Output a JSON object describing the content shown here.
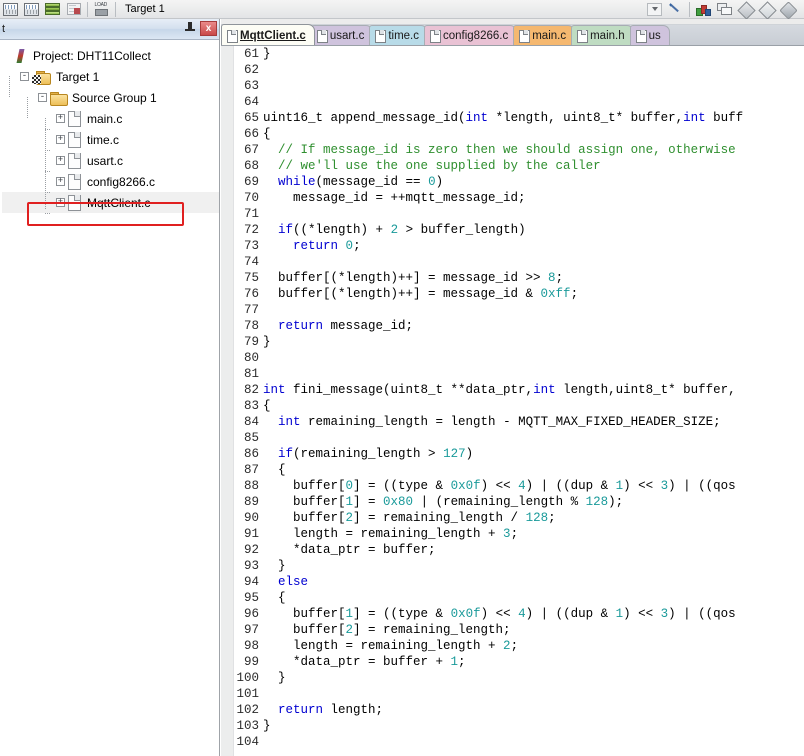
{
  "toolbar": {
    "target_label": "Target 1",
    "icons_left": [
      {
        "name": "build-icon",
        "title": "Build"
      },
      {
        "name": "rebuild-icon",
        "title": "Rebuild"
      },
      {
        "name": "batch-build-icon",
        "title": "Batch Build"
      },
      {
        "name": "stop-build-icon",
        "title": "Stop Build"
      },
      {
        "name": "download-load-icon",
        "title": "LOAD"
      }
    ],
    "icons_right": [
      {
        "name": "target-dropdown-icon",
        "title": "Select Target"
      },
      {
        "name": "options-for-target-wand-icon",
        "title": "Options for Target"
      },
      {
        "name": "manage-components-icon",
        "title": "Manage Components"
      },
      {
        "name": "manage-windows-icon",
        "title": "Manage Windows"
      },
      {
        "name": "insert-element-icon",
        "title": "Insert Element"
      },
      {
        "name": "new-element-icon",
        "title": "New Element"
      },
      {
        "name": "multi-element-icon",
        "title": "Multi Element"
      }
    ]
  },
  "project_panel": {
    "header_title": "t",
    "pin_label": "",
    "close_label": "x",
    "tree": [
      {
        "label": "Project: DHT11Collect",
        "icon": "project-icon",
        "indent": 0,
        "expander": "",
        "selected": false,
        "highlight": false
      },
      {
        "label": "Target 1",
        "icon": "target-folder-icon",
        "indent": 1,
        "expander": "-",
        "selected": false,
        "highlight": false
      },
      {
        "label": "Source Group 1",
        "icon": "folder-icon",
        "indent": 2,
        "expander": "-",
        "selected": false,
        "highlight": false
      },
      {
        "label": "main.c",
        "icon": "file-icon",
        "indent": 3,
        "expander": "+",
        "selected": false,
        "highlight": false
      },
      {
        "label": "time.c",
        "icon": "file-icon",
        "indent": 3,
        "expander": "+",
        "selected": false,
        "highlight": false
      },
      {
        "label": "usart.c",
        "icon": "file-icon",
        "indent": 3,
        "expander": "+",
        "selected": false,
        "highlight": false
      },
      {
        "label": "config8266.c",
        "icon": "file-icon",
        "indent": 3,
        "expander": "+",
        "selected": false,
        "highlight": false
      },
      {
        "label": "MqttClient.c",
        "icon": "file-icon",
        "indent": 3,
        "expander": "+",
        "selected": true,
        "highlight": true
      }
    ]
  },
  "editor": {
    "tabs": [
      {
        "label": "MqttClient.c",
        "color": "#fdfdf5",
        "active": true
      },
      {
        "label": "usart.c",
        "color": "#cfc3dd",
        "active": false
      },
      {
        "label": "time.c",
        "color": "#b8dbe8",
        "active": false
      },
      {
        "label": "config8266.c",
        "color": "#e9c2d4",
        "active": false
      },
      {
        "label": "main.c",
        "color": "#f5b870",
        "active": false
      },
      {
        "label": "main.h",
        "color": "#bfdcc2",
        "active": false
      },
      {
        "label": "us",
        "color": "#cfc3dd",
        "active": false
      }
    ],
    "first_line_number": 61,
    "code_lines": [
      {
        "n": 61,
        "tokens": [
          {
            "t": "}",
            "c": ""
          }
        ]
      },
      {
        "n": 62,
        "tokens": []
      },
      {
        "n": 63,
        "tokens": []
      },
      {
        "n": 64,
        "tokens": []
      },
      {
        "n": 65,
        "tokens": [
          {
            "t": "uint16_t append_message_id(",
            "c": ""
          },
          {
            "t": "int",
            "c": "kw"
          },
          {
            "t": " *length, uint8_t* buffer,",
            "c": ""
          },
          {
            "t": "int",
            "c": "kw"
          },
          {
            "t": " buff",
            "c": ""
          }
        ]
      },
      {
        "n": 66,
        "tokens": [
          {
            "t": "{",
            "c": ""
          }
        ]
      },
      {
        "n": 67,
        "tokens": [
          {
            "t": "  ",
            "c": ""
          },
          {
            "t": "// If message_id is zero then we should assign one, otherwise",
            "c": "cm"
          }
        ]
      },
      {
        "n": 68,
        "tokens": [
          {
            "t": "  ",
            "c": ""
          },
          {
            "t": "// we'll use the one supplied by the caller",
            "c": "cm"
          }
        ]
      },
      {
        "n": 69,
        "tokens": [
          {
            "t": "  ",
            "c": ""
          },
          {
            "t": "while",
            "c": "kw"
          },
          {
            "t": "(message_id == ",
            "c": ""
          },
          {
            "t": "0",
            "c": "num"
          },
          {
            "t": ")",
            "c": ""
          }
        ]
      },
      {
        "n": 70,
        "tokens": [
          {
            "t": "    message_id = ++mqtt_message_id;",
            "c": ""
          }
        ]
      },
      {
        "n": 71,
        "tokens": []
      },
      {
        "n": 72,
        "tokens": [
          {
            "t": "  ",
            "c": ""
          },
          {
            "t": "if",
            "c": "kw"
          },
          {
            "t": "((*length) + ",
            "c": ""
          },
          {
            "t": "2",
            "c": "num"
          },
          {
            "t": " > buffer_length)",
            "c": ""
          }
        ]
      },
      {
        "n": 73,
        "tokens": [
          {
            "t": "    ",
            "c": ""
          },
          {
            "t": "return",
            "c": "kw"
          },
          {
            "t": " ",
            "c": ""
          },
          {
            "t": "0",
            "c": "num"
          },
          {
            "t": ";",
            "c": ""
          }
        ]
      },
      {
        "n": 74,
        "tokens": []
      },
      {
        "n": 75,
        "tokens": [
          {
            "t": "  buffer[(*length)++] = message_id >> ",
            "c": ""
          },
          {
            "t": "8",
            "c": "num"
          },
          {
            "t": ";",
            "c": ""
          }
        ]
      },
      {
        "n": 76,
        "tokens": [
          {
            "t": "  buffer[(*length)++] = message_id & ",
            "c": ""
          },
          {
            "t": "0xff",
            "c": "num"
          },
          {
            "t": ";",
            "c": ""
          }
        ]
      },
      {
        "n": 77,
        "tokens": []
      },
      {
        "n": 78,
        "tokens": [
          {
            "t": "  ",
            "c": ""
          },
          {
            "t": "return",
            "c": "kw"
          },
          {
            "t": " message_id;",
            "c": ""
          }
        ]
      },
      {
        "n": 79,
        "tokens": [
          {
            "t": "}",
            "c": ""
          }
        ]
      },
      {
        "n": 80,
        "tokens": []
      },
      {
        "n": 81,
        "tokens": []
      },
      {
        "n": 82,
        "tokens": [
          {
            "t": "int",
            "c": "kw"
          },
          {
            "t": " fini_message(uint8_t **data_ptr,",
            "c": ""
          },
          {
            "t": "int",
            "c": "kw"
          },
          {
            "t": " length,uint8_t* buffer,",
            "c": ""
          }
        ]
      },
      {
        "n": 83,
        "tokens": [
          {
            "t": "{",
            "c": ""
          }
        ]
      },
      {
        "n": 84,
        "tokens": [
          {
            "t": "  ",
            "c": ""
          },
          {
            "t": "int",
            "c": "kw"
          },
          {
            "t": " remaining_length = length - MQTT_MAX_FIXED_HEADER_SIZE;",
            "c": ""
          }
        ]
      },
      {
        "n": 85,
        "tokens": []
      },
      {
        "n": 86,
        "tokens": [
          {
            "t": "  ",
            "c": ""
          },
          {
            "t": "if",
            "c": "kw"
          },
          {
            "t": "(remaining_length > ",
            "c": ""
          },
          {
            "t": "127",
            "c": "num"
          },
          {
            "t": ")",
            "c": ""
          }
        ]
      },
      {
        "n": 87,
        "tokens": [
          {
            "t": "  {",
            "c": ""
          }
        ]
      },
      {
        "n": 88,
        "tokens": [
          {
            "t": "    buffer[",
            "c": ""
          },
          {
            "t": "0",
            "c": "num"
          },
          {
            "t": "] = ((type & ",
            "c": ""
          },
          {
            "t": "0x0f",
            "c": "num"
          },
          {
            "t": ") << ",
            "c": ""
          },
          {
            "t": "4",
            "c": "num"
          },
          {
            "t": ") | ((dup & ",
            "c": ""
          },
          {
            "t": "1",
            "c": "num"
          },
          {
            "t": ") << ",
            "c": ""
          },
          {
            "t": "3",
            "c": "num"
          },
          {
            "t": ") | ((qos",
            "c": ""
          }
        ]
      },
      {
        "n": 89,
        "tokens": [
          {
            "t": "    buffer[",
            "c": ""
          },
          {
            "t": "1",
            "c": "num"
          },
          {
            "t": "] = ",
            "c": ""
          },
          {
            "t": "0x80",
            "c": "num"
          },
          {
            "t": " | (remaining_length % ",
            "c": ""
          },
          {
            "t": "128",
            "c": "num"
          },
          {
            "t": ");",
            "c": ""
          }
        ]
      },
      {
        "n": 90,
        "tokens": [
          {
            "t": "    buffer[",
            "c": ""
          },
          {
            "t": "2",
            "c": "num"
          },
          {
            "t": "] = remaining_length / ",
            "c": ""
          },
          {
            "t": "128",
            "c": "num"
          },
          {
            "t": ";",
            "c": ""
          }
        ]
      },
      {
        "n": 91,
        "tokens": [
          {
            "t": "    length = remaining_length + ",
            "c": ""
          },
          {
            "t": "3",
            "c": "num"
          },
          {
            "t": ";",
            "c": ""
          }
        ]
      },
      {
        "n": 92,
        "tokens": [
          {
            "t": "    *data_ptr = buffer;",
            "c": ""
          }
        ]
      },
      {
        "n": 93,
        "tokens": [
          {
            "t": "  }",
            "c": ""
          }
        ]
      },
      {
        "n": 94,
        "tokens": [
          {
            "t": "  ",
            "c": ""
          },
          {
            "t": "else",
            "c": "kw"
          }
        ]
      },
      {
        "n": 95,
        "tokens": [
          {
            "t": "  {",
            "c": ""
          }
        ]
      },
      {
        "n": 96,
        "tokens": [
          {
            "t": "    buffer[",
            "c": ""
          },
          {
            "t": "1",
            "c": "num"
          },
          {
            "t": "] = ((type & ",
            "c": ""
          },
          {
            "t": "0x0f",
            "c": "num"
          },
          {
            "t": ") << ",
            "c": ""
          },
          {
            "t": "4",
            "c": "num"
          },
          {
            "t": ") | ((dup & ",
            "c": ""
          },
          {
            "t": "1",
            "c": "num"
          },
          {
            "t": ") << ",
            "c": ""
          },
          {
            "t": "3",
            "c": "num"
          },
          {
            "t": ") | ((qos",
            "c": ""
          }
        ]
      },
      {
        "n": 97,
        "tokens": [
          {
            "t": "    buffer[",
            "c": ""
          },
          {
            "t": "2",
            "c": "num"
          },
          {
            "t": "] = remaining_length;",
            "c": ""
          }
        ]
      },
      {
        "n": 98,
        "tokens": [
          {
            "t": "    length = remaining_length + ",
            "c": ""
          },
          {
            "t": "2",
            "c": "num"
          },
          {
            "t": ";",
            "c": ""
          }
        ]
      },
      {
        "n": 99,
        "tokens": [
          {
            "t": "    *data_ptr = buffer + ",
            "c": ""
          },
          {
            "t": "1",
            "c": "num"
          },
          {
            "t": ";",
            "c": ""
          }
        ]
      },
      {
        "n": 100,
        "tokens": [
          {
            "t": "  }",
            "c": ""
          }
        ]
      },
      {
        "n": 101,
        "tokens": []
      },
      {
        "n": 102,
        "tokens": [
          {
            "t": "  ",
            "c": ""
          },
          {
            "t": "return",
            "c": "kw"
          },
          {
            "t": " length;",
            "c": ""
          }
        ]
      },
      {
        "n": 103,
        "tokens": [
          {
            "t": "}",
            "c": ""
          }
        ]
      },
      {
        "n": 104,
        "tokens": []
      }
    ]
  },
  "colors": {
    "keyword": "#0000d0",
    "comment": "#2f8f2f",
    "number": "#1a9a9a",
    "highlight_box": "#e02020",
    "close_button": "#c94a4a"
  }
}
